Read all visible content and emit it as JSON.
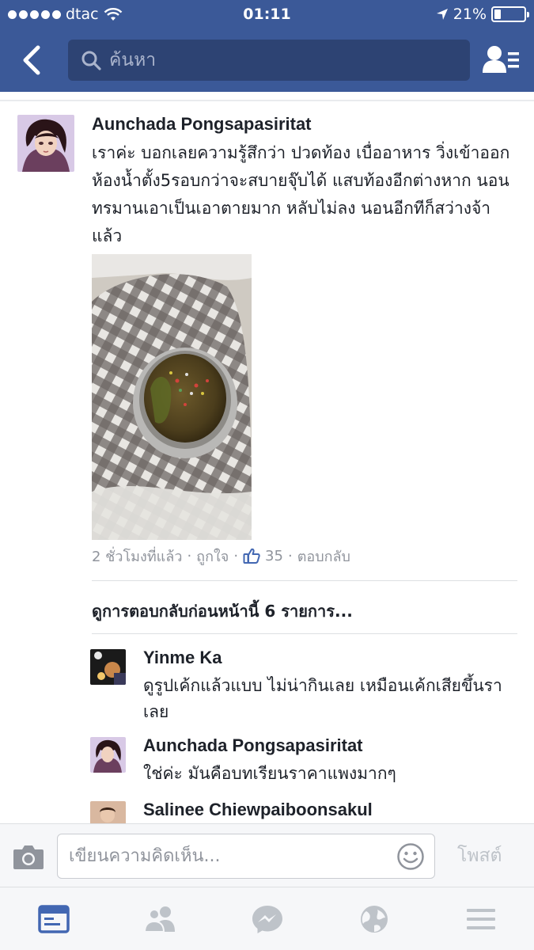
{
  "status_bar": {
    "carrier": "dtac",
    "time": "01:11",
    "battery": "21%",
    "battery_level": 0.21
  },
  "nav": {
    "search_placeholder": "ค้นหา"
  },
  "post": {
    "author": "Aunchada Pongsapasiritat",
    "text": "เราค่ะ บอกเลยความรู้สึกว่า  ปวดท้อง เบื่ออาหาร วิ่งเข้าออกห้องน้ำตั้ง5รอบกว่าจะสบายจุ๊บได้ แสบท้องอีกต่างหาก นอนทรมานเอาเป็นเอาตายมาก หลับไม่ลง นอนอีกทีก็สว่างจ้าแล้ว",
    "time": "2 ชั่วโมงที่แล้ว",
    "like_label": "ถูกใจ",
    "like_count": "35",
    "reply_label": "ตอบกลับ",
    "previous_replies": "ดูการตอบกลับก่อนหน้านี้ 6 รายการ..."
  },
  "replies": [
    {
      "name": "Yinme Ka",
      "text": "ดูรูปเค้กแล้วแบบ ไม่น่ากินเลย เหมือนเค้กเสียขึ้นราเลย"
    },
    {
      "name": "Aunchada Pongsapasiritat",
      "text": "ใช่ค่ะ มันคือบทเรียนราคาแพงมากๆ"
    },
    {
      "name": "Salinee Chiewpaiboonsakul",
      "text": ""
    }
  ],
  "composer": {
    "placeholder": "เขียนความคิดเห็น...",
    "post_label": "โพสต์"
  },
  "colors": {
    "brand": "#3b5998",
    "secondary_text": "#90949c"
  },
  "tabs": [
    "news-feed-icon",
    "friends-icon",
    "messenger-icon",
    "globe-icon",
    "menu-icon"
  ]
}
